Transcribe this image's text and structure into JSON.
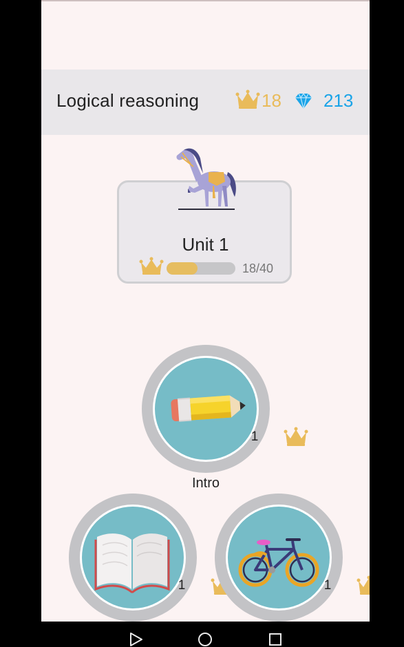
{
  "header": {
    "title": "Logical reasoning",
    "crowns": "18",
    "gems": "213",
    "crown_color": "#e9bb5a",
    "gem_color": "#1aa4e8"
  },
  "unit": {
    "title": "Unit 1",
    "progress_label": "18/40",
    "progress_fraction": 0.45,
    "icon": "horse-illustration"
  },
  "lessons": [
    {
      "label": "Intro",
      "level": "1",
      "icon": "pencil-icon"
    },
    {
      "label": "",
      "level": "1",
      "icon": "open-book-icon"
    },
    {
      "label": "",
      "level": "1",
      "icon": "bicycle-icon"
    }
  ],
  "navbar": {
    "buttons": [
      "back-triangle-icon",
      "home-circle-icon",
      "recents-square-icon"
    ]
  }
}
